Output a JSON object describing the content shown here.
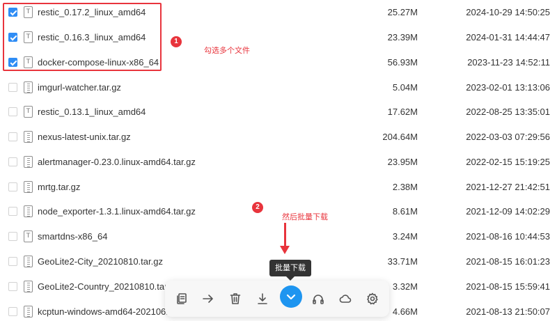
{
  "files": [
    {
      "name": "restic_0.17.2_linux_amd64",
      "size": "25.27M",
      "date": "2024-10-29 14:50:25",
      "checked": true,
      "icon": "text-file-icon"
    },
    {
      "name": "restic_0.16.3_linux_amd64",
      "size": "23.39M",
      "date": "2024-01-31 14:44:47",
      "checked": true,
      "icon": "text-file-icon"
    },
    {
      "name": "docker-compose-linux-x86_64",
      "size": "56.93M",
      "date": "2023-11-23 14:52:11",
      "checked": true,
      "icon": "text-file-icon"
    },
    {
      "name": "imgurl-watcher.tar.gz",
      "size": "5.04M",
      "date": "2023-02-01 13:13:06",
      "checked": false,
      "icon": "archive-file-icon"
    },
    {
      "name": "restic_0.13.1_linux_amd64",
      "size": "17.62M",
      "date": "2022-08-25 13:35:01",
      "checked": false,
      "icon": "text-file-icon"
    },
    {
      "name": "nexus-latest-unix.tar.gz",
      "size": "204.64M",
      "date": "2022-03-03 07:29:56",
      "checked": false,
      "icon": "archive-file-icon"
    },
    {
      "name": "alertmanager-0.23.0.linux-amd64.tar.gz",
      "size": "23.95M",
      "date": "2022-02-15 15:19:25",
      "checked": false,
      "icon": "archive-file-icon"
    },
    {
      "name": "mrtg.tar.gz",
      "size": "2.38M",
      "date": "2021-12-27 21:42:51",
      "checked": false,
      "icon": "archive-file-icon"
    },
    {
      "name": "node_exporter-1.3.1.linux-amd64.tar.gz",
      "size": "8.61M",
      "date": "2021-12-09 14:02:29",
      "checked": false,
      "icon": "archive-file-icon"
    },
    {
      "name": "smartdns-x86_64",
      "size": "3.24M",
      "date": "2021-08-16 10:44:53",
      "checked": false,
      "icon": "text-file-icon"
    },
    {
      "name": "GeoLite2-City_20210810.tar.gz",
      "size": "33.71M",
      "date": "2021-08-15 16:01:23",
      "checked": false,
      "icon": "archive-file-icon"
    },
    {
      "name": "GeoLite2-Country_20210810.tar.gz",
      "size": "3.32M",
      "date": "2021-08-15 15:59:41",
      "checked": false,
      "icon": "archive-file-icon"
    },
    {
      "name": "kcptun-windows-amd64-2021062",
      "size": "4.66M",
      "date": "2021-08-13 21:50:07",
      "checked": false,
      "icon": "archive-file-icon"
    }
  ],
  "annotations": {
    "step1_number": "1",
    "step1_text": "勾选多个文件",
    "step2_number": "2",
    "step2_text": "然后批量下载"
  },
  "tooltip": "批量下载",
  "toolbar": [
    {
      "name": "copy-icon"
    },
    {
      "name": "move-arrow-icon"
    },
    {
      "name": "trash-icon"
    },
    {
      "name": "download-icon"
    },
    {
      "name": "batch-download-icon",
      "primary": true
    },
    {
      "name": "headphones-icon"
    },
    {
      "name": "cloud-icon"
    },
    {
      "name": "settings-gear-icon"
    }
  ],
  "colors": {
    "accent": "#1e95f0",
    "checkbox": "#2f8df5",
    "annotation": "#e8343c"
  }
}
